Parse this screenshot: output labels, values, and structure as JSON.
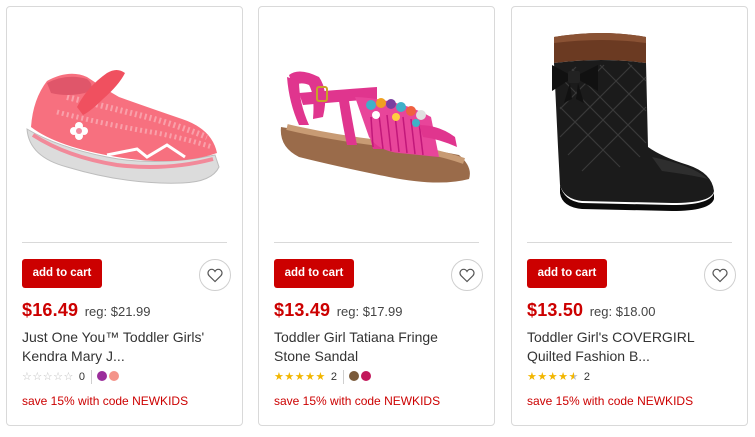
{
  "colors": {
    "accent": "#cc0000",
    "star": "#f2b600",
    "star_empty": "#bdbdbd"
  },
  "products": [
    {
      "image": "pink-mary-jane-sneaker",
      "add_to_cart": "add to cart",
      "favorite_icon": "heart-outline-icon",
      "price": "$16.49",
      "reg_price": "reg: $21.99",
      "title_line1": "Just One You™ Toddler Girls'",
      "title_line2": "Kendra Mary J...",
      "rating": 0,
      "review_count": "0",
      "swatches": [
        "#9b2e9b",
        "#f4948a"
      ],
      "promo": "save 15% with code NEWKIDS"
    },
    {
      "image": "pink-fringe-sandal",
      "add_to_cart": "add to cart",
      "favorite_icon": "heart-outline-icon",
      "price": "$13.49",
      "reg_price": "reg: $17.99",
      "title_line1": "Toddler Girl Tatiana Fringe",
      "title_line2": "Stone Sandal",
      "rating": 5,
      "review_count": "2",
      "swatches": [
        "#7a5a3a",
        "#c2185b"
      ],
      "promo": "save 15% with code NEWKIDS"
    },
    {
      "image": "black-quilted-boot",
      "add_to_cart": "add to cart",
      "favorite_icon": "heart-outline-icon",
      "price": "$13.50",
      "reg_price": "reg: $18.00",
      "title_line1": "Toddler Girl's COVERGIRL",
      "title_line2": "Quilted Fashion B...",
      "rating": 4.5,
      "review_count": "2",
      "swatches": [],
      "promo": "save 15% with code NEWKIDS"
    }
  ]
}
